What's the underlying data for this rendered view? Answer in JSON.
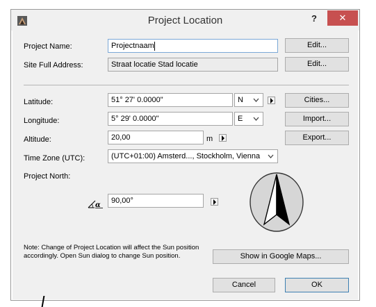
{
  "window": {
    "title": "Project Location",
    "help_label": "?",
    "close_label": "✕"
  },
  "fields": {
    "project_name": {
      "label": "Project Name:",
      "value": "Projectnaam",
      "button": "Edit..."
    },
    "site_address": {
      "label": "Site Full Address:",
      "value": "Straat locatie Stad locatie",
      "button": "Edit..."
    },
    "latitude": {
      "label": "Latitude:",
      "value": "51° 27' 0.0000\"",
      "hemisphere": "N",
      "button": "Cities..."
    },
    "longitude": {
      "label": "Longitude:",
      "value": "5° 29' 0.0000\"",
      "hemisphere": "E",
      "button": "Import..."
    },
    "altitude": {
      "label": "Altitude:",
      "value": "20,00",
      "unit": "m",
      "button": "Export..."
    },
    "time_zone": {
      "label": "Time Zone (UTC):",
      "value": "(UTC+01:00) Amsterd..., Stockholm, Vienna"
    },
    "project_north": {
      "label": "Project North:",
      "angle_symbol": "α",
      "value": "90,00°"
    }
  },
  "note": "Note: Change of Project Location will affect the Sun position accordingly. Open Sun dialog to change Sun position.",
  "buttons": {
    "google_maps": "Show in Google Maps...",
    "cancel": "Cancel",
    "ok": "OK"
  },
  "icons": {
    "app": "archicad-icon",
    "compass": "compass-north-arrow-icon"
  },
  "colors": {
    "close_button": "#c75050",
    "dialog_bg": "#f0f0f0",
    "default_button_border": "#3c7fb1"
  }
}
